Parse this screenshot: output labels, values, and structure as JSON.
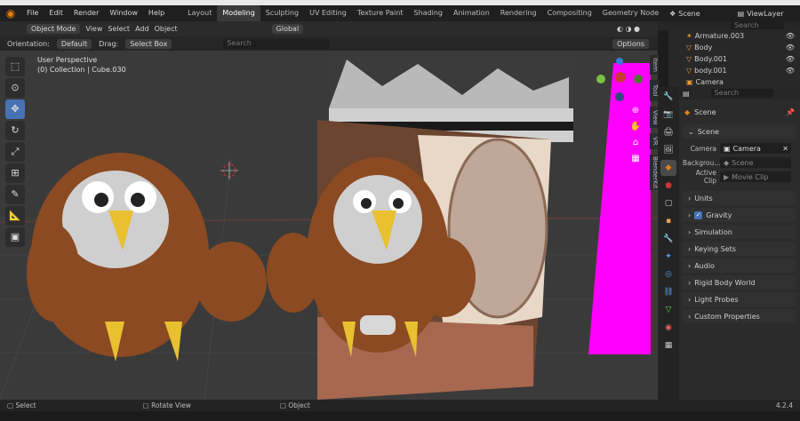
{
  "menubar": {
    "menus": [
      "File",
      "Edit",
      "Render",
      "Window",
      "Help"
    ],
    "workspaces": [
      "Layout",
      "Modeling",
      "Sculpting",
      "UV Editing",
      "Texture Paint",
      "Shading",
      "Animation",
      "Rendering",
      "Compositing",
      "Geometry Node"
    ],
    "active_workspace": "Modeling",
    "scene": "Scene",
    "view_layer": "ViewLayer"
  },
  "header": {
    "mode": "Object Mode",
    "menus": [
      "View",
      "Select",
      "Add",
      "Object"
    ],
    "transform": "Global",
    "options": "Options"
  },
  "toolheader": {
    "orientation_label": "Orientation:",
    "orientation_value": "Default",
    "drag_label": "Drag:",
    "drag_value": "Select Box",
    "search_placeholder": "Search"
  },
  "viewport": {
    "perspective": "User Perspective",
    "collection": "(0) Collection | Cube.030",
    "side_tabs": [
      "Item",
      "Tool",
      "View",
      "VR",
      "BlenderKit"
    ]
  },
  "outliner": {
    "items": [
      "Armature.003",
      "Body",
      "Body.001",
      "body.001",
      "Camera"
    ],
    "search_placeholder": "Search"
  },
  "properties": {
    "search_placeholder": "Search",
    "context": "Scene",
    "panel": "Scene",
    "camera_label": "Camera",
    "camera_value": "Camera",
    "background_label": "Backgrou...",
    "background_value": "Scene",
    "active_clip_label": "Active Clip",
    "active_clip_value": "Movie Clip",
    "sections": [
      "Units",
      "Gravity",
      "Simulation",
      "Keying Sets",
      "Audio",
      "Rigid Body World",
      "Light Probes",
      "Custom Properties"
    ]
  },
  "status": {
    "select": "Select",
    "rotate": "Rotate View",
    "object": "Object",
    "version": "4.2.4"
  },
  "colors": {
    "accent": "#4772b3",
    "magenta": "#ff00ff",
    "owl": "#8b4a22"
  }
}
